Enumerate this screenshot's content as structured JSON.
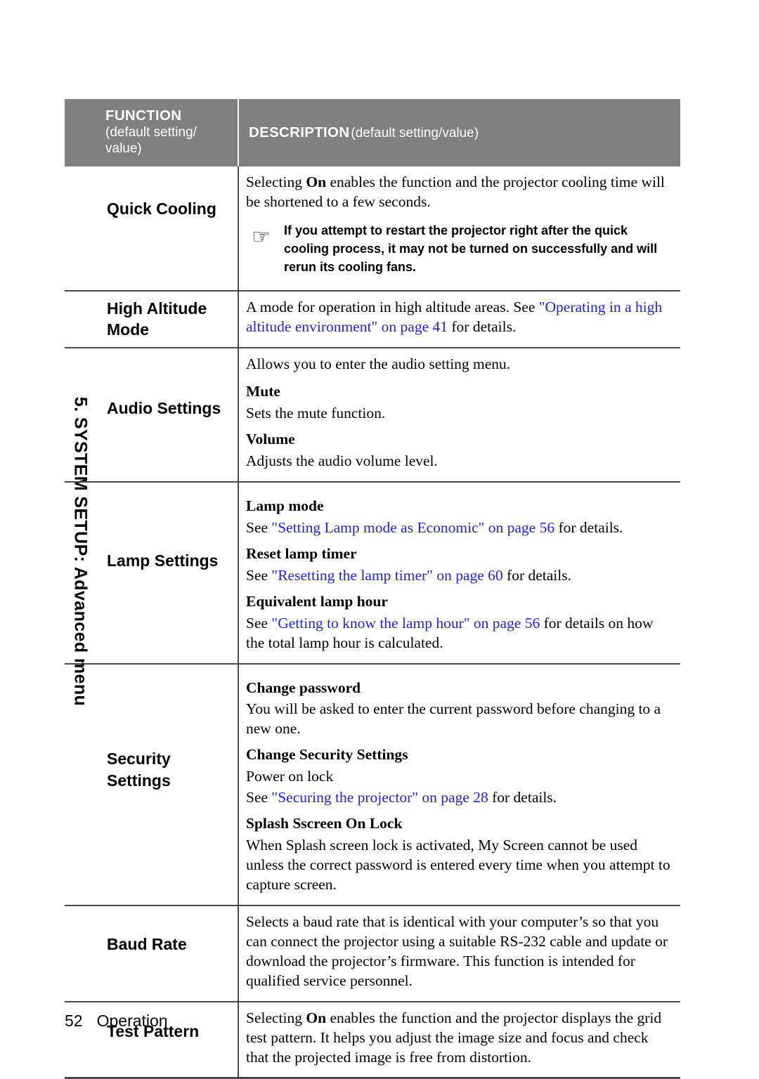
{
  "sidebar": {
    "section_label": "5. SYSTEM SETUP: Advanced menu"
  },
  "table": {
    "header": {
      "function_title": "FUNCTION",
      "function_subtitle": "(default setting/ value)",
      "description_title": "DESCRIPTION",
      "description_subtitle": "(default setting/value)"
    },
    "rows": [
      {
        "function": "Quick Cooling",
        "desc_intro_pre": "Selecting ",
        "desc_intro_bold": "On",
        "desc_intro_post": " enables the function and the projector cooling time will be shortened to a few seconds.",
        "note_icon": "pointing-hand-icon",
        "note": "If you attempt to restart the projector right after the quick cooling process, it may not be turned on successfully and will rerun its cooling fans."
      },
      {
        "function": "High Altitude Mode",
        "pre": "A mode for operation in high altitude areas. See ",
        "link": "\"Operating in a high altitude environment\" on page 41",
        "post": " for details."
      },
      {
        "function": "Audio Settings",
        "intro": "Allows you to enter the audio setting menu.",
        "items": [
          {
            "head": "Mute",
            "body": "Sets the mute function."
          },
          {
            "head": "Volume",
            "body": "Adjusts the audio volume level."
          }
        ]
      },
      {
        "function": "Lamp Settings",
        "items": [
          {
            "head": "Lamp mode",
            "pre": "See ",
            "link": "\"Setting Lamp mode as Economic\" on page 56",
            "post": " for details."
          },
          {
            "head": "Reset lamp timer",
            "pre": "See ",
            "link": "\"Resetting the lamp timer\" on page 60",
            "post": " for details."
          },
          {
            "head": "Equivalent lamp hour",
            "pre": "See ",
            "link": "\"Getting to know the lamp hour\" on page 56",
            "post": " for details on how the total lamp hour is calculated."
          }
        ]
      },
      {
        "function": "Security Settings",
        "items": [
          {
            "head": "Change password",
            "body": "You will be asked to enter the current password before changing to a new one."
          },
          {
            "head": "Change Security Settings",
            "sub": "Power on lock",
            "pre": "See ",
            "link": "\"Securing the projector\" on page 28",
            "post": " for details."
          },
          {
            "head": "Splash Sscreen On Lock",
            "body": "When Splash screen lock is activated, My Screen cannot be used unless the correct password is entered every time when you attempt to capture screen."
          }
        ]
      },
      {
        "function": "Baud Rate",
        "body": "Selects a baud rate that is identical with your computer’s so that you can connect the projector using a suitable RS-232 cable and update or download the projector’s firmware. This function is intended for qualified service personnel."
      },
      {
        "function": "Test Pattern",
        "pre": "Selecting ",
        "bold": "On",
        "post": " enables the function and the projector displays the grid test pattern. It helps you adjust the image size and focus and check that the projected image is free from distortion."
      }
    ]
  },
  "footer": {
    "page_number": "52",
    "section": "Operation"
  },
  "colors": {
    "header_background": "#808080",
    "link": "#2222e8",
    "rule": "#4a4a4a"
  },
  "icons": {
    "pointing_hand": "☞"
  }
}
